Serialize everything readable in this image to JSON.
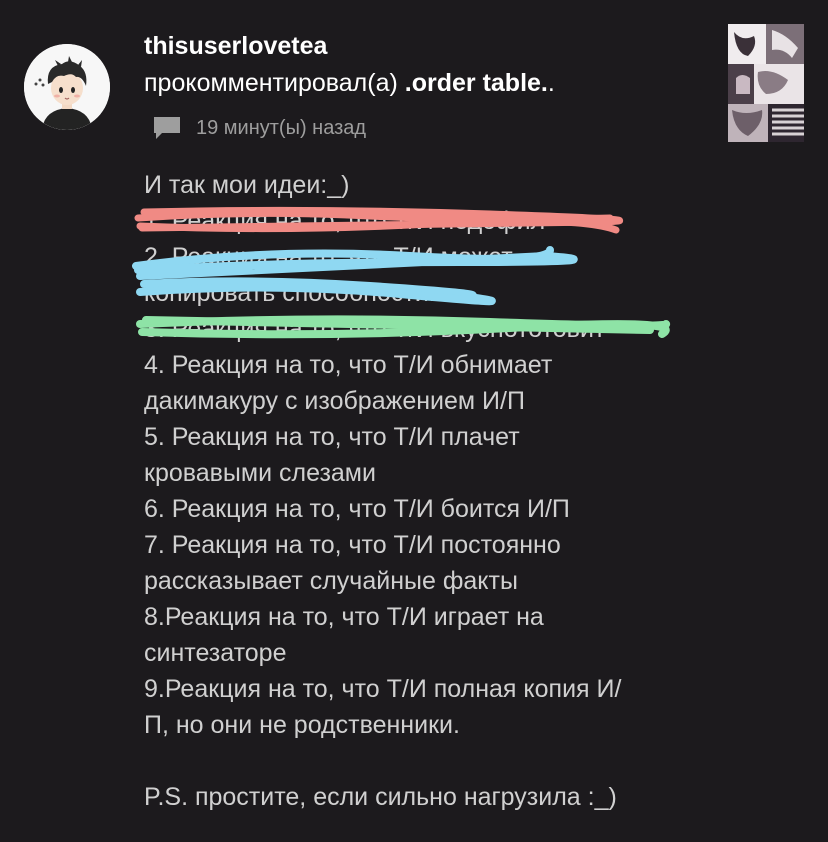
{
  "post": {
    "username": "thisuserlovetea",
    "action_text": "прокомментировал(а) ",
    "target_title": ".order table.",
    "target_suffix": ".",
    "timestamp": "19 минут(ы) назад"
  },
  "comment": {
    "lines": [
      "И так мои идеи:_)",
      "1. Реакция на то, что Т/И педофил",
      "2. Реакция на то, что Т/И может",
      "копировать способности.",
      "3. Реакция на то, что Т/И вкуснототовит",
      "4. Реакция на то, что Т/И обнимает",
      "дакимакуру с изображением И/П",
      "5. Реакция на то, что Т/И плачет",
      "кровавыми слезами",
      "6. Реакция на то, что Т/И боится И/П",
      "7. Реакция на то, что Т/И постоянно",
      "рассказывает случайные факты",
      "8.Реакция на то, что Т/И играет на",
      "синтезаторе",
      "9.Реакция на то, что Т/И полная копия И/",
      "П, но они не родственники.",
      "",
      "P.S. простите, если сильно нагрузила :_)"
    ]
  },
  "icons": {
    "comment": "speech-bubble-icon",
    "avatar": "anime-boy-avatar",
    "thumbnail": "manga-collage-thumbnail"
  },
  "colors": {
    "background": "#1c1a1d",
    "text": "#d0d0d0",
    "meta": "#9e9e9e",
    "scribble_red": "#f08a84",
    "scribble_blue": "#8fd8f2",
    "scribble_green": "#8ee3a6"
  }
}
